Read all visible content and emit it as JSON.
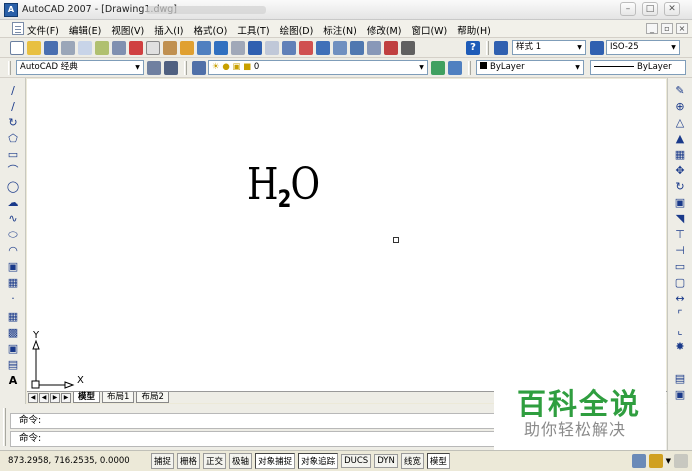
{
  "window": {
    "title": "AutoCAD 2007 - [Drawing1.dwg]",
    "app_icon": "A"
  },
  "menubar": {
    "items": [
      "文件(F)",
      "编辑(E)",
      "视图(V)",
      "插入(I)",
      "格式(O)",
      "工具(T)",
      "绘图(D)",
      "标注(N)",
      "修改(M)",
      "窗口(W)",
      "帮助(H)"
    ]
  },
  "toolbar": {
    "text_style": "样式 1",
    "dim_style": "ISO-25",
    "workspace": "AutoCAD 经典",
    "layer": "0",
    "color": "ByLayer",
    "linetype": "ByLayer",
    "help": "?"
  },
  "drawing": {
    "formula_main": "H",
    "formula_sub": "2",
    "formula_tail": "O",
    "ucs_y": "Y",
    "ucs_x": "X"
  },
  "layout_tabs": [
    "模型",
    "布局1",
    "布局2"
  ],
  "command": {
    "line1": "命令:",
    "line2": "命令:"
  },
  "statusbar": {
    "coords": "873.2958, 716.2535, 0.0000",
    "buttons": [
      "捕捉",
      "栅格",
      "正交",
      "极轴",
      "对象捕捉",
      "对象追踪",
      "DUCS",
      "DYN",
      "线宽",
      "模型"
    ]
  },
  "watermark": {
    "title": "百科全说",
    "subtitle": "助你轻松解决"
  }
}
